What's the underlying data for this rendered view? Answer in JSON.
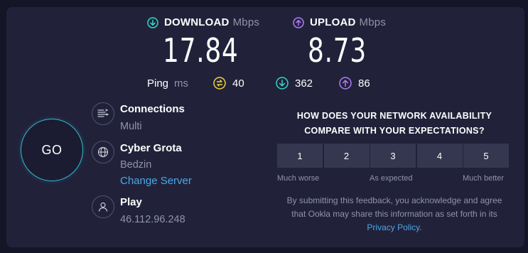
{
  "download": {
    "label": "DOWNLOAD",
    "unit": "Mbps",
    "value": "17.84",
    "color": "#33d6c8"
  },
  "upload": {
    "label": "UPLOAD",
    "unit": "Mbps",
    "value": "8.73",
    "color": "#b07bf4"
  },
  "ping": {
    "label": "Ping",
    "unit": "ms",
    "idle": "40",
    "download": "362",
    "upload": "86",
    "idle_color": "#f3d23c",
    "download_color": "#33d6c8",
    "upload_color": "#b07bf4"
  },
  "go_button": {
    "label": "GO",
    "color": "#33b8cc"
  },
  "connections": {
    "title": "Connections",
    "value": "Multi",
    "icon": "connections-icon"
  },
  "server": {
    "title": "Cyber Grota",
    "location": "Bedzin",
    "change_link": "Change Server",
    "icon": "globe-icon"
  },
  "provider": {
    "title": "Play",
    "ip": "46.112.96.248",
    "icon": "user-icon"
  },
  "feedback": {
    "question_line1": "HOW DOES YOUR NETWORK AVAILABILITY",
    "question_line2": "COMPARE WITH YOUR EXPECTATIONS?",
    "ratings": [
      "1",
      "2",
      "3",
      "4",
      "5"
    ],
    "label_low": "Much worse",
    "label_mid": "As expected",
    "label_high": "Much better",
    "disclaimer_text": "By submitting this feedback, you acknowledge and agree that Ookla may share this information as set forth in its",
    "privacy_link": "Privacy Policy",
    "period": "."
  }
}
